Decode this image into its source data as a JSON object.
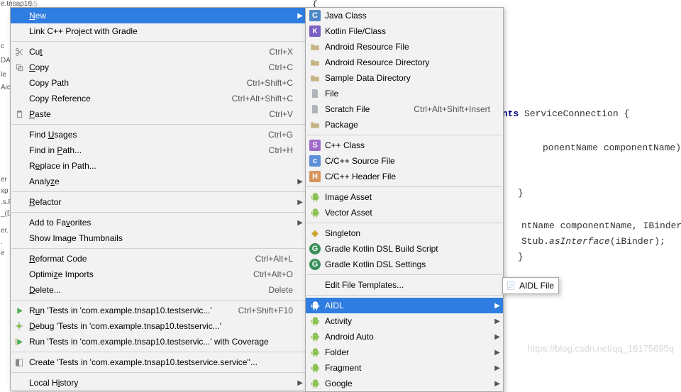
{
  "left_frag": [
    "e.tnsap10",
    "c",
    "DA",
    "le",
    "Aic",
    "er",
    "xp",
    ".s.P",
    "_(D",
    "er.",
    ".",
    "e"
  ],
  "gutter_line": "55",
  "code": {
    "l1": "ents",
    "l1b": " ServiceConnection {",
    "l2": "ponentName componentName) {",
    "l3": "ntName componentName, IBinder iBin",
    "l4a": "Stub.",
    "l4b": "asInterface",
    "l4c": "(iBinder);"
  },
  "ctx1": [
    {
      "label": "New",
      "ul": "N",
      "arrow": true,
      "selected": true
    },
    {
      "label": "Link C++ Project with Gradle"
    },
    {
      "sep": true
    },
    {
      "icon": "scissors",
      "label": "Cut",
      "ul": "t",
      "shortcut": "Ctrl+X"
    },
    {
      "icon": "copy",
      "label": "Copy",
      "ul": "C",
      "shortcut": "Ctrl+C"
    },
    {
      "label": "Copy Path",
      "shortcut": "Ctrl+Shift+C"
    },
    {
      "label": "Copy Reference",
      "shortcut": "Ctrl+Alt+Shift+C"
    },
    {
      "icon": "paste",
      "label": "Paste",
      "ul": "P",
      "shortcut": "Ctrl+V"
    },
    {
      "sep": true
    },
    {
      "label": "Find Usages",
      "ul": "U",
      "shortcut": "Ctrl+G"
    },
    {
      "label": "Find in Path...",
      "ul": "P",
      "shortcut": "Ctrl+H"
    },
    {
      "label": "Replace in Path...",
      "ul": "e"
    },
    {
      "label": "Analyze",
      "ul": "z",
      "arrow": true
    },
    {
      "sep": true
    },
    {
      "label": "Refactor",
      "ul": "R",
      "arrow": true
    },
    {
      "sep": true
    },
    {
      "label": "Add to Favorites",
      "ul": "v",
      "arrow": true
    },
    {
      "label": "Show Image Thumbnails"
    },
    {
      "sep": true
    },
    {
      "label": "Reformat Code",
      "ul": "R",
      "shortcut": "Ctrl+Alt+L"
    },
    {
      "label": "Optimize Imports",
      "ul": "z",
      "shortcut": "Ctrl+Alt+O"
    },
    {
      "label": "Delete...",
      "ul": "D",
      "shortcut": "Delete"
    },
    {
      "sep": true
    },
    {
      "icon": "run",
      "label": "Run 'Tests in 'com.example.tnsap10.testservic...'",
      "ul": "u",
      "shortcut": "Ctrl+Shift+F10"
    },
    {
      "icon": "debug",
      "label": "Debug 'Tests in 'com.example.tnsap10.testservic...'",
      "ul": "D"
    },
    {
      "icon": "runcov",
      "label": "Run 'Tests in 'com.example.tnsap10.testservic...' with Coverage"
    },
    {
      "sep": true
    },
    {
      "icon": "tag",
      "label": "Create 'Tests in 'com.example.tnsap10.testservice.service''..."
    },
    {
      "sep": true
    },
    {
      "label": "Local History",
      "ul": "i",
      "arrow": true
    }
  ],
  "ctx2": [
    {
      "icon": "c",
      "label": "Java Class"
    },
    {
      "icon": "k",
      "label": "Kotlin File/Class"
    },
    {
      "icon": "folder",
      "label": "Android Resource File"
    },
    {
      "icon": "folder",
      "label": "Android Resource Directory"
    },
    {
      "icon": "folder",
      "label": "Sample Data Directory"
    },
    {
      "icon": "file",
      "label": "File"
    },
    {
      "icon": "file",
      "label": "Scratch File",
      "shortcut": "Ctrl+Alt+Shift+Insert"
    },
    {
      "icon": "folder",
      "label": "Package"
    },
    {
      "sep": true
    },
    {
      "icon": "sq-s",
      "label": "C++ Class"
    },
    {
      "icon": "sq-c",
      "label": "C/C++ Source File"
    },
    {
      "icon": "sq-h",
      "label": "C/C++ Header File"
    },
    {
      "sep": true
    },
    {
      "icon": "android",
      "label": "Image Asset"
    },
    {
      "icon": "android",
      "label": "Vector Asset"
    },
    {
      "sep": true
    },
    {
      "icon": "pin",
      "label": "Singleton"
    },
    {
      "icon": "g",
      "label": "Gradle Kotlin DSL Build Script"
    },
    {
      "icon": "g",
      "label": "Gradle Kotlin DSL Settings"
    },
    {
      "sep": true
    },
    {
      "label": "Edit File Templates..."
    },
    {
      "sep": true
    },
    {
      "icon": "android",
      "label": "AIDL",
      "arrow": true,
      "selected": true
    },
    {
      "icon": "android",
      "label": "Activity",
      "arrow": true
    },
    {
      "icon": "android",
      "label": "Android Auto",
      "arrow": true
    },
    {
      "icon": "android",
      "label": "Folder",
      "arrow": true
    },
    {
      "icon": "android",
      "label": "Fragment",
      "arrow": true
    },
    {
      "icon": "android",
      "label": "Google",
      "arrow": true
    }
  ],
  "ctx3": [
    {
      "icon": "aidl",
      "label": "AIDL File"
    }
  ],
  "watermark": "https://blog.csdn.net/qq_16175695q"
}
